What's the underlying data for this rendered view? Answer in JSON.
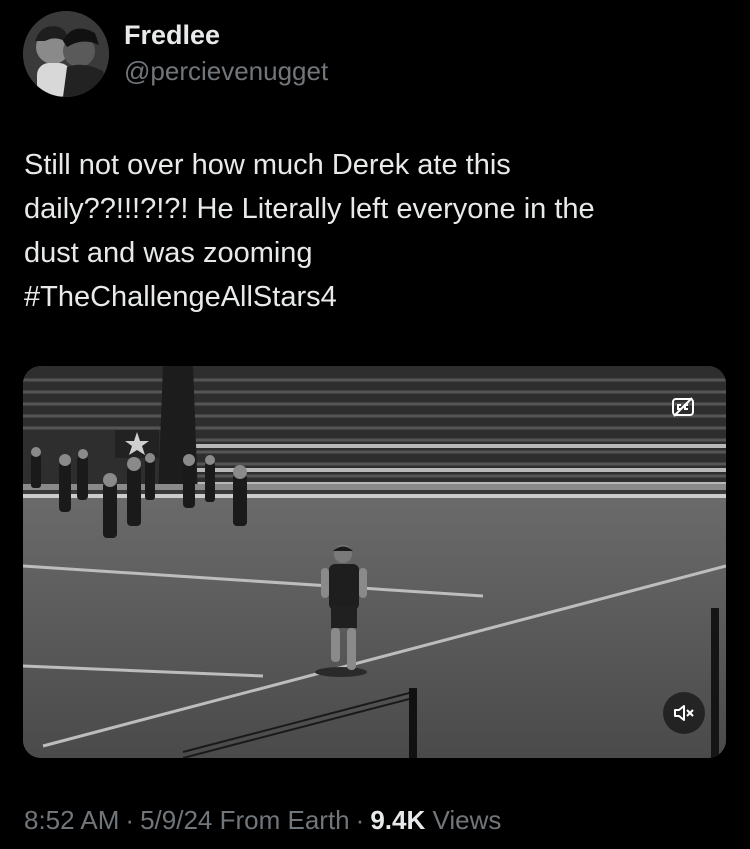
{
  "author": {
    "display_name": "Fredlee",
    "handle": "@percievenugget",
    "avatar_icon": "profile-photo"
  },
  "tweet": {
    "lines": [
      "Still not over how much Derek ate this",
      "daily??!!!?!?! He Literally left everyone in the",
      "dust and was zooming"
    ],
    "hashtag": "#TheChallengeAllStars4"
  },
  "media": {
    "type": "video",
    "cc_icon": "captions-icon",
    "mute_icon": "muted-speaker-icon"
  },
  "meta": {
    "time": "8:52 AM",
    "date": "5/9/24",
    "source": "From Earth",
    "views_count": "9.4K",
    "views_label": "Views",
    "separator": "·"
  },
  "colors": {
    "background": "#000000",
    "primary_text": "#e7e9ea",
    "secondary_text": "#71767b"
  }
}
